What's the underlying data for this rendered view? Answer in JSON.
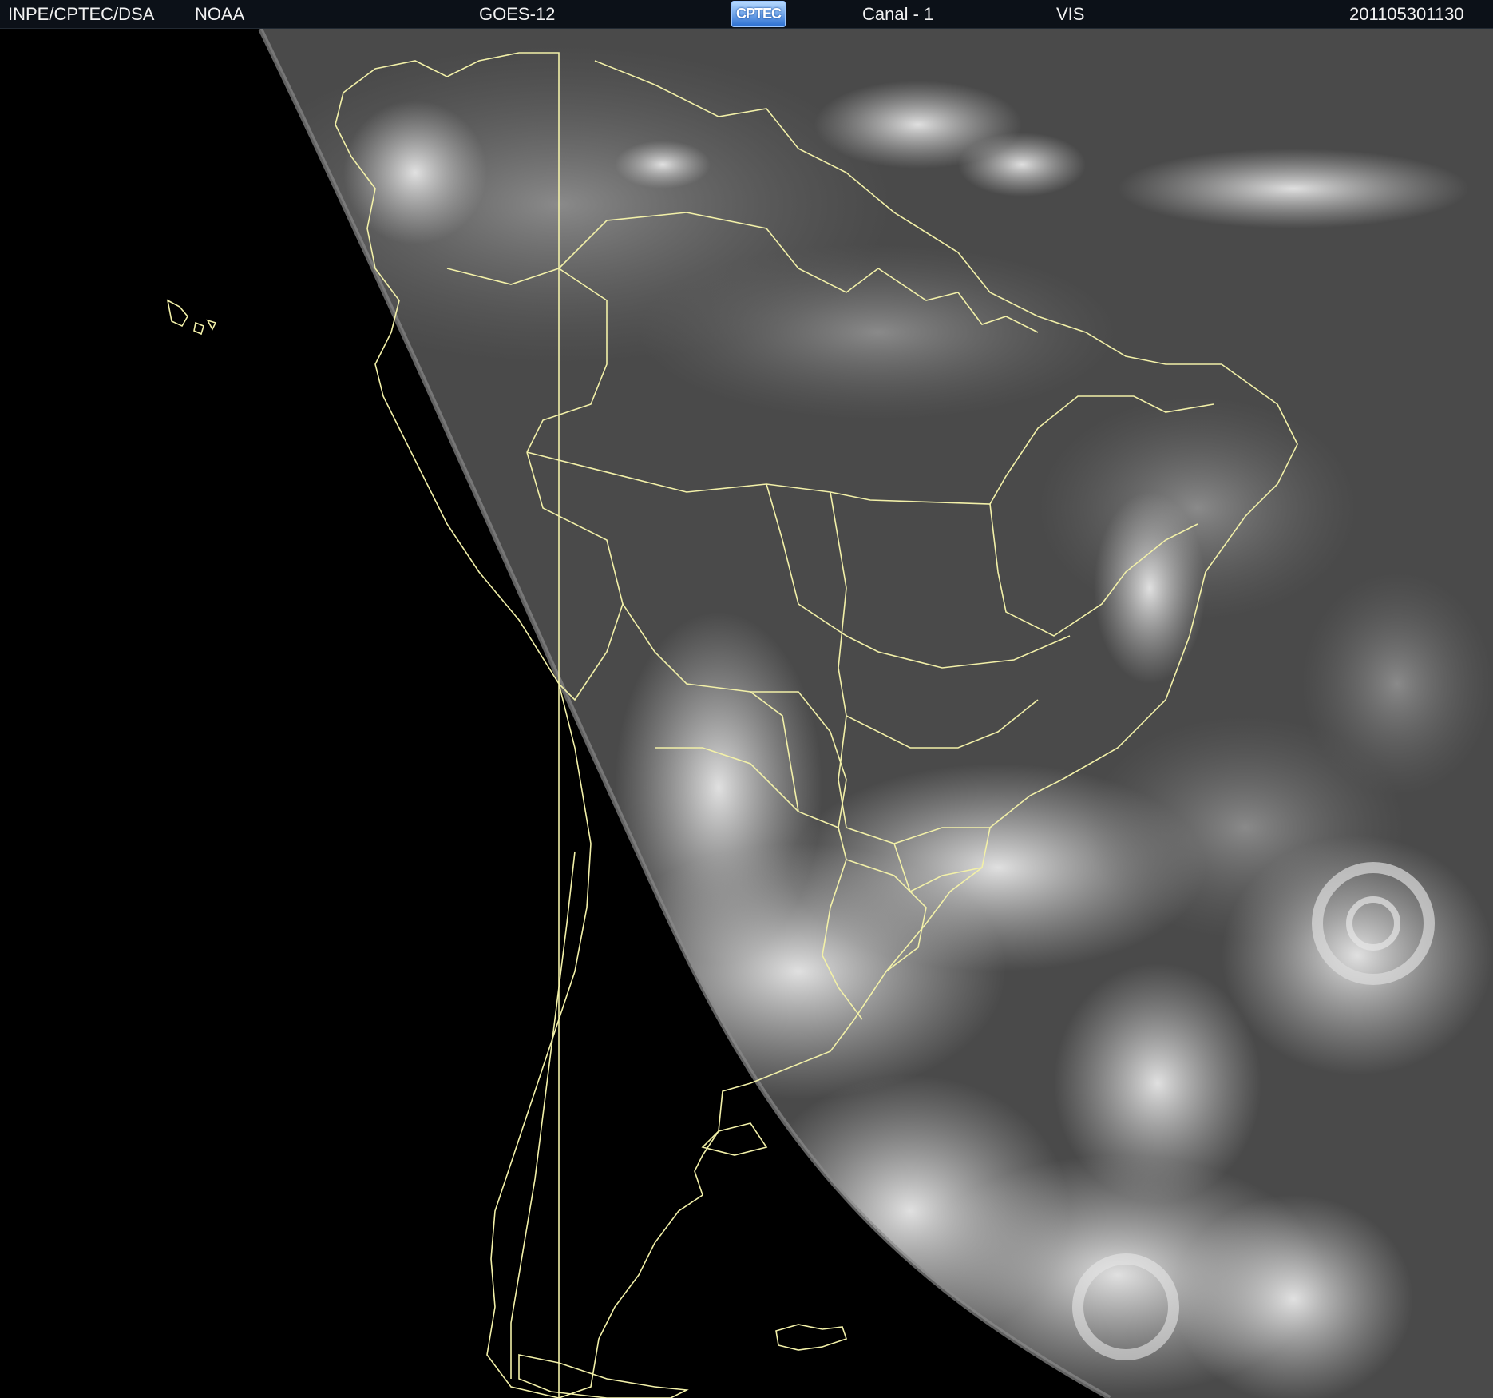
{
  "header": {
    "agency": "INPE/CPTEC/DSA",
    "source": "NOAA",
    "satellite": "GOES-12",
    "logo_text": "CPTEC",
    "channel": "Canal - 1",
    "band": "VIS",
    "timestamp": "201105301130"
  },
  "map": {
    "background_color": "#000000",
    "earth_color": "#4a4a4a",
    "cloud_color": "#d8d8d8",
    "border_color": "#f2f0a8",
    "header_color": "#0c1118"
  }
}
